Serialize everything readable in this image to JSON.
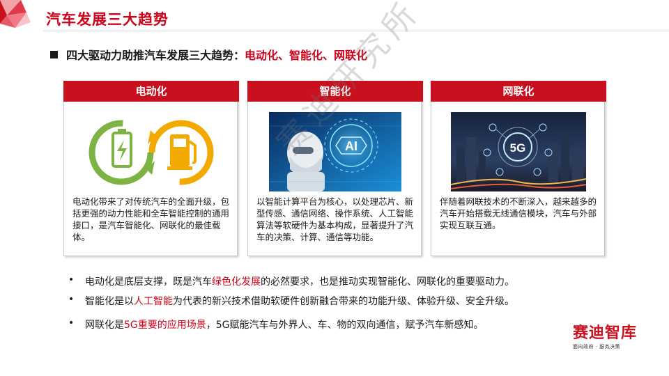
{
  "header": {
    "title": "汽车发展三大趋势"
  },
  "subheading": {
    "prefix": "四大驱动力助推汽车发展三大趋势：",
    "highlight": "电动化、智能化、网联化"
  },
  "cards": [
    {
      "title": "电动化",
      "text": "电动化带来了对传统汽车的全面升级，包括更强的动力性能和全车智能控制的通用接口，是汽车智能化、网联化的最佳载体。",
      "image_icon": "battery-and-fuel-pump-icon"
    },
    {
      "title": "智能化",
      "text": "以智能计算平台为核心，以处理芯片、新型传感、通信网络、操作系统、人工智能算法等软硬件为基本构成，显著提升了汽车的决策、计算、通信等功能。",
      "image_icon": "ai-robot-icon",
      "image_label": "AI"
    },
    {
      "title": "网联化",
      "text": "伴随着网联技术的不断深入，越来越多的汽车开始搭载无线通信模块，汽车与外部实现互联互通。",
      "image_icon": "5g-city-icon",
      "image_label": "5G"
    }
  ],
  "bullets": [
    {
      "marker": "•",
      "before": "电动化是底层支撑，既是汽车",
      "highlight": "绿色化发展",
      "after": "的必然要求，也是推动实现智能化、网联化的重要驱动力。"
    },
    {
      "marker": "•",
      "before": "智能化是以",
      "highlight": "人工智能",
      "after": "为代表的新兴技术借助软硬件创新融合带来的功能升级、体验升级、安全升级。"
    },
    {
      "marker": "•",
      "before": "网联化是",
      "highlight": "5G重要的应用场景",
      "after": "，5G赋能汽车与外界人、车、物的双向通信，赋予汽车新感知。"
    }
  ],
  "brand": {
    "name": "赛迪智库",
    "tagline": "面向政府 · 服务决策"
  },
  "watermark": {
    "text": "赛迪研究所"
  },
  "colors": {
    "accent_red": "#d0021b",
    "header_red": "#c8101e",
    "battery_green": "#7cb342",
    "pump_orange": "#f2a900"
  }
}
